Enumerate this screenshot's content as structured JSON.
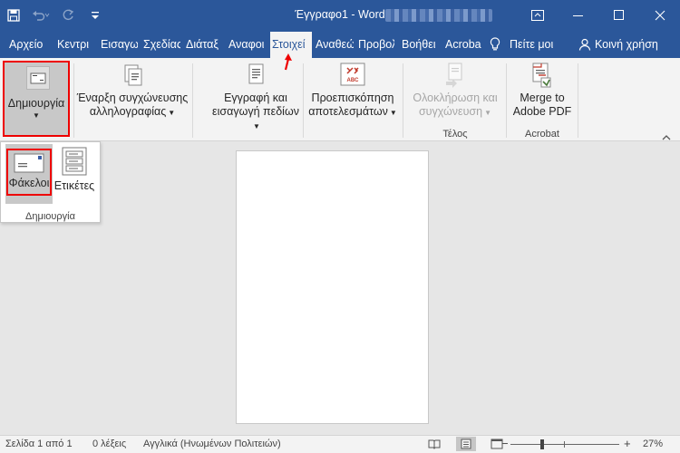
{
  "window": {
    "title": "Έγγραφο1  -  Word"
  },
  "tabs": [
    {
      "label": "Αρχείο"
    },
    {
      "label": "Κεντρι"
    },
    {
      "label": "Εισαγω"
    },
    {
      "label": "Σχεδίας"
    },
    {
      "label": "Διάταξ"
    },
    {
      "label": "Αναφοι"
    },
    {
      "label": "Στοιχεί",
      "active": true
    },
    {
      "label": "Αναθεώ"
    },
    {
      "label": "Προβολ"
    },
    {
      "label": "Βοήθει"
    },
    {
      "label": "Acroba"
    }
  ],
  "tell_me": "Πείτε μοι",
  "share": "Κοινή χρήση",
  "ribbon": {
    "create": {
      "label": "Δημιουργία"
    },
    "start_merge": {
      "line1": "Έναρξη συγχώνευσης",
      "line2": "αλληλογραφίας"
    },
    "write_insert": {
      "line1": "Εγγραφή και",
      "line2": "εισαγωγή πεδίων"
    },
    "preview": {
      "line1": "Προεπισκόπηση",
      "line2": "αποτελεσμάτων",
      "icon_text": "ABC"
    },
    "finish": {
      "line1": "Ολοκλήρωση και",
      "line2": "συγχώνευση",
      "group": "Τέλος"
    },
    "acrobat": {
      "line1": "Merge to",
      "line2": "Adobe PDF",
      "group": "Acrobat"
    }
  },
  "dropdown": {
    "envelopes": "Φάκελοι",
    "labels": "Ετικέτες",
    "group": "Δημιουργία"
  },
  "status": {
    "page": "Σελίδα 1 από 1",
    "words": "0 λέξεις",
    "language": "Αγγλικά (Ηνωμένων Πολιτειών)",
    "zoom_minus": "−",
    "zoom_plus": "+",
    "zoom": "27%"
  },
  "colors": {
    "title_bar": "#2b579a",
    "highlight": "#e00000",
    "ribbon": "#f3f3f3",
    "canvas": "#e6e6e6"
  }
}
